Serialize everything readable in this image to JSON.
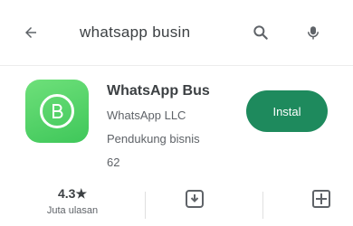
{
  "search": {
    "query": "whatsapp busin"
  },
  "app": {
    "name": "WhatsApp Bus",
    "developer": "WhatsApp LLC",
    "type": "Pendukung bisnis",
    "size": "62",
    "install_label": "Instal",
    "icon_color": "#4cd964"
  },
  "stats": {
    "rating": "4.3★",
    "rating_sub": "Juta ulasan"
  },
  "colors": {
    "accent": "#1e8a5d"
  }
}
